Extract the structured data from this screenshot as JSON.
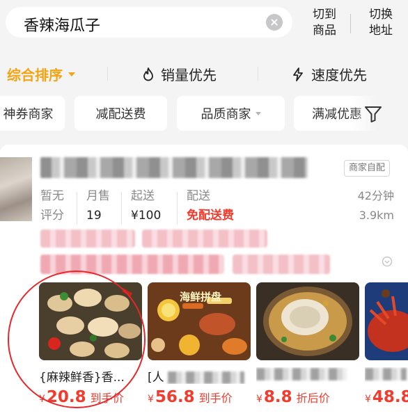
{
  "search": {
    "query": "香辣海瓜子"
  },
  "header": {
    "switch_product": [
      "切到",
      "商品"
    ],
    "switch_address": [
      "切换",
      "地址"
    ]
  },
  "sort": {
    "comprehensive": "综合排序",
    "sales": "销量优先",
    "speed": "速度优先",
    "active_color": "#f3a413"
  },
  "filters": [
    "神券商家",
    "减配送费",
    "品质商家",
    "满减优惠"
  ],
  "store": {
    "delivery_tag": "商家自配",
    "rating": [
      "暂无",
      "评分"
    ],
    "monthly_sales_label": "月售",
    "monthly_sales_value": "19",
    "min_order_label": "起送",
    "min_order_value": "¥100",
    "delivery_label": "配送",
    "delivery_value": "免配送费",
    "eta": "42分钟",
    "distance": "3.9km"
  },
  "dishes": [
    {
      "name": "{麻辣鲜香}香...",
      "price": "20.8",
      "suffix": "到手价"
    },
    {
      "name": "[人",
      "price": "56.8",
      "suffix": "到手价",
      "image_caption": "海鲜拼盘"
    },
    {
      "name": "",
      "price": "8.8",
      "suffix": "折后价"
    },
    {
      "name": "",
      "price": "48.8",
      "suffix": ""
    }
  ],
  "currency": "¥",
  "price_color": "#f23b2d"
}
